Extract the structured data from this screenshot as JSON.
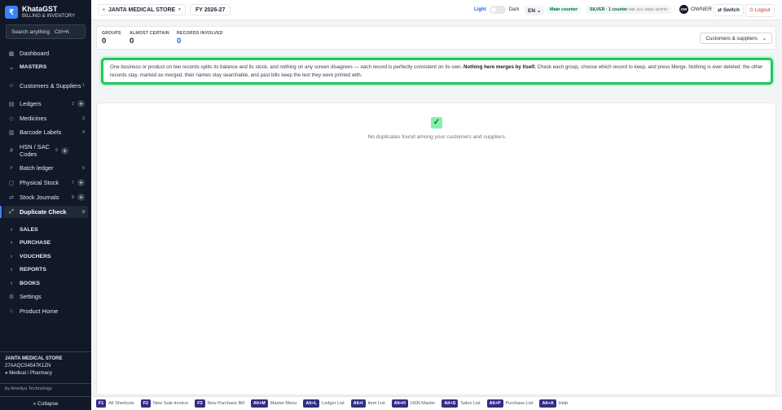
{
  "app": {
    "logo_letter": "₹",
    "name": "KhataGST",
    "subtitle": "BILLING & INVENTORY"
  },
  "search": {
    "label": "Search anything",
    "shortcut": "Ctrl+K"
  },
  "sidebar": {
    "items": [
      {
        "label": "Dashboard",
        "icon": "grid-icon",
        "glyph": "▦"
      },
      {
        "label": "MASTERS",
        "icon": "chevron-down-icon",
        "glyph": "⌄"
      },
      {
        "label": "Customers & Suppliers",
        "icon": "users-icon",
        "glyph": "☺",
        "count": "1"
      },
      {
        "label": "Ledgers",
        "icon": "book-icon",
        "glyph": "▤",
        "count": "2"
      },
      {
        "label": "Medicines",
        "icon": "tag-icon",
        "glyph": "◇",
        "count": "3"
      },
      {
        "label": "Barcode Labels",
        "icon": "barcode-icon",
        "glyph": "▥",
        "count": "4"
      },
      {
        "label": "HSN / SAC Codes",
        "icon": "hash-icon",
        "glyph": "#",
        "count": "5"
      },
      {
        "label": "Batch ledger",
        "icon": "search-icon",
        "glyph": "⌕",
        "count": "6"
      },
      {
        "label": "Physical Stock",
        "icon": "clipboard-icon",
        "glyph": "▢",
        "count": "7"
      },
      {
        "label": "Stock Journals",
        "icon": "shuffle-icon",
        "glyph": "⇄",
        "count": "8"
      },
      {
        "label": "Duplicate Check",
        "icon": "merge-icon",
        "glyph": "⤢",
        "count": "9"
      },
      {
        "label": "SALES",
        "icon": "chevron-right-icon",
        "glyph": "›"
      },
      {
        "label": "PURCHASE",
        "icon": "chevron-right-icon",
        "glyph": "›"
      },
      {
        "label": "VOUCHERS",
        "icon": "chevron-right-icon",
        "glyph": "›"
      },
      {
        "label": "REPORTS",
        "icon": "chevron-right-icon",
        "glyph": "›"
      },
      {
        "label": "BOOKS",
        "icon": "chevron-right-icon",
        "glyph": "›"
      },
      {
        "label": "Settings",
        "icon": "gear-icon",
        "glyph": "⚙"
      },
      {
        "label": "Product Home",
        "icon": "home-icon",
        "glyph": "⌂"
      }
    ],
    "plus": "+",
    "footer": {
      "store": "JANTA MEDICAL STORE",
      "gstin": "27AAQCS4547K1ZN",
      "type": "Medical / Pharmacy",
      "by": "by Anedya Technology"
    },
    "collapse": "« Collapse"
  },
  "topbar": {
    "store": "JANTA MEDICAL STORE",
    "fy": "FY 2026-27",
    "light": "Light",
    "dark": "Dark",
    "lang": "EN",
    "main_counter": "Main counter",
    "plan": "SILVER · 1 counter",
    "device": "AND-SLV-2026-4E7F97",
    "avatar": "OW",
    "role": "OWNER",
    "switch": "⇄ Switch",
    "logout": "Logout"
  },
  "stats": {
    "groups_label": "GROUPS",
    "groups": "0",
    "almost_label": "ALMOST CERTAIN",
    "almost": "0",
    "records_label": "RECORDS INVOLVED",
    "records": "0",
    "filter": "Customers & suppliers"
  },
  "notice": {
    "pre": "One business or product on two records splits its balance and its stock, and nothing on any screen disagrees — each record is perfectly consistent on its own. ",
    "bold": "Nothing here merges by itself.",
    "post": " Check each group, choose which record to keep, and press Merge. Nothing is ever deleted: the other records stay, marked as merged, their names stay searchable, and past bills keep the text they were printed with."
  },
  "empty": {
    "text": "No duplicates found among your customers and suppliers."
  },
  "footer": [
    {
      "key": "F1",
      "label": "All Shortcuts"
    },
    {
      "key": "F2",
      "label": "New Sale Invoice"
    },
    {
      "key": "F3",
      "label": "New Purchase Bill"
    },
    {
      "key": "Alt+M",
      "label": "Master Menu"
    },
    {
      "key": "Alt+L",
      "label": "Ledger List"
    },
    {
      "key": "Alt+I",
      "label": "Item List"
    },
    {
      "key": "Alt+H",
      "label": "HSN Master"
    },
    {
      "key": "Alt+S",
      "label": "Sales List"
    },
    {
      "key": "Alt+P",
      "label": "Purchase List"
    },
    {
      "key": "Alt+A",
      "label": "Help"
    }
  ]
}
